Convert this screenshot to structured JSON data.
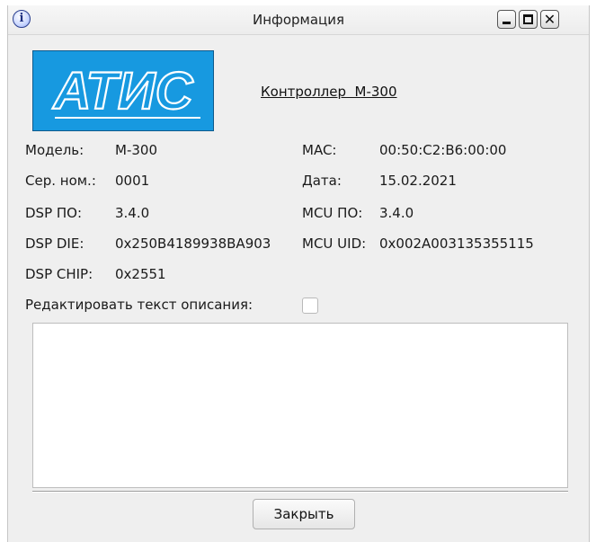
{
  "window": {
    "title": "Информация",
    "info_icon_glyph": "i",
    "close_glyph": "✕",
    "icons": [
      "info-icon",
      "minimize-icon",
      "maximize-icon",
      "close-icon"
    ]
  },
  "logo": {
    "text": "АТИС",
    "background": "#1799e0"
  },
  "controller_title": "Контроллер  М-300",
  "fields": {
    "model": {
      "label": "Модель:",
      "value": "М-300"
    },
    "serial": {
      "label": "Сер. ном.:",
      "value": "0001"
    },
    "dsp_po": {
      "label": "DSP ПО:",
      "value": "3.4.0"
    },
    "dsp_die": {
      "label": "DSP DIE:",
      "value": "0x250B4189938BA903"
    },
    "dsp_chip": {
      "label": "DSP CHIP:",
      "value": "0x2551"
    },
    "mac": {
      "label": "MAC:",
      "value": "00:50:C2:B6:00:00"
    },
    "date": {
      "label": "Дата:",
      "value": "15.02.2021"
    },
    "mcu_po": {
      "label": "MCU ПО:",
      "value": "3.4.0"
    },
    "mcu_uid": {
      "label": "MCU UID:",
      "value": "0x002A003135355115"
    }
  },
  "edit_description": {
    "label": "Редактировать текст описания:",
    "checked": false
  },
  "description": {
    "value": ""
  },
  "buttons": {
    "close_label": "Закрыть"
  }
}
